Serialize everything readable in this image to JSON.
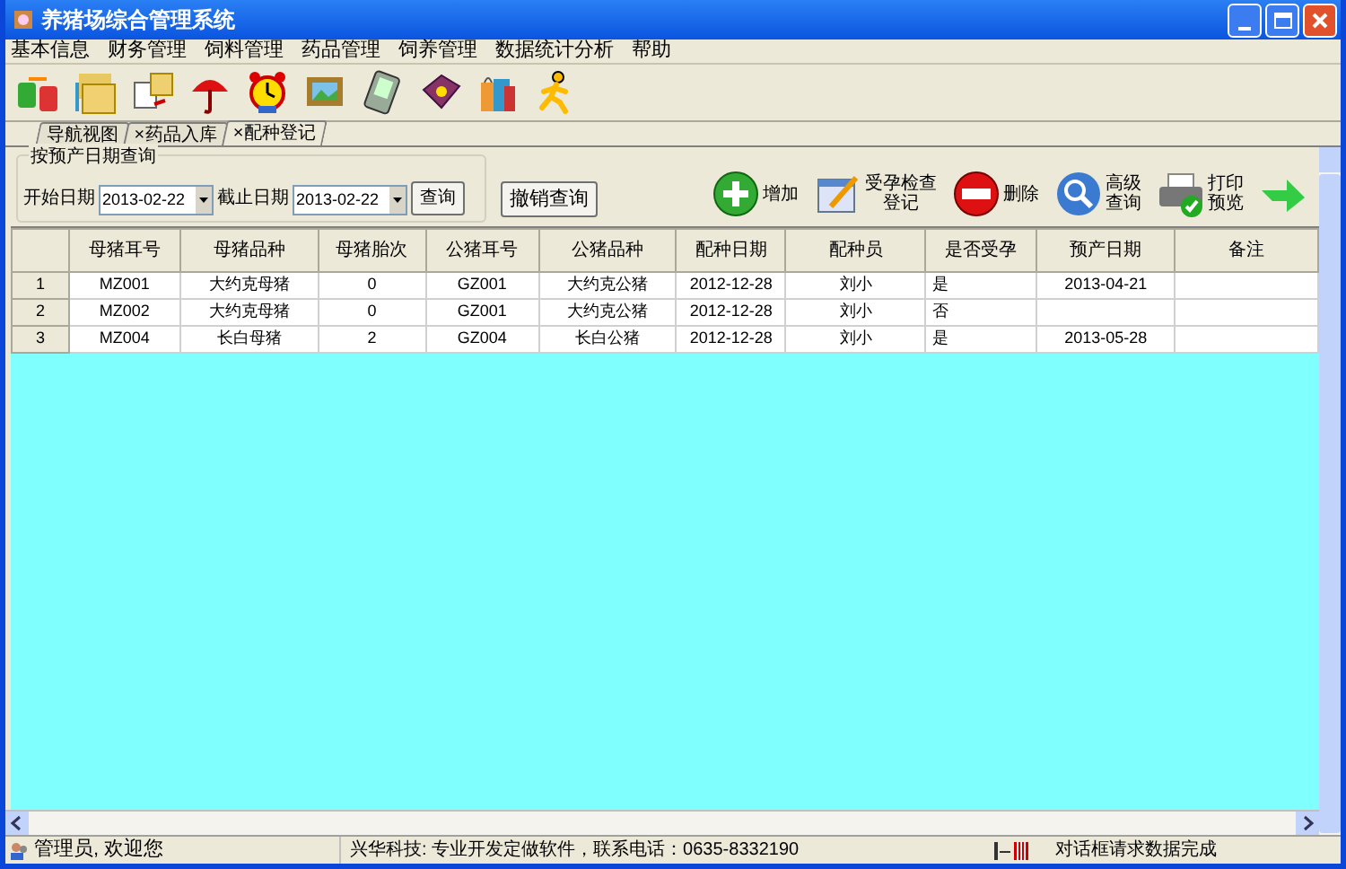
{
  "window": {
    "title": "养猪场综合管理系统"
  },
  "menu": [
    "基本信息",
    "财务管理",
    "饲料管理",
    "药品管理",
    "饲养管理",
    "数据统计分析",
    "帮助"
  ],
  "toolbar": [
    {
      "kind": "exchange"
    },
    {
      "kind": "folders"
    },
    {
      "kind": "documents"
    },
    {
      "kind": "umbrella"
    },
    {
      "kind": "clock"
    },
    {
      "kind": "picture"
    },
    {
      "kind": "pda"
    },
    {
      "kind": "book"
    },
    {
      "kind": "gift"
    },
    {
      "kind": "runner"
    }
  ],
  "tabs": [
    {
      "label": "导航视图",
      "selected": false
    },
    {
      "label": "药品入库",
      "close": "×",
      "selected": false
    },
    {
      "label": "配种登记",
      "close": "×",
      "selected": true
    }
  ],
  "query": {
    "title": "按预产日期查询",
    "start_label": "开始日期",
    "start_value": "2013-02-22",
    "end_label": "截止日期",
    "end_value": "2013-02-22",
    "search_button": "查询",
    "cancel_button": "撤销查询"
  },
  "actions": [
    {
      "kind": "add",
      "lines": [
        "增加"
      ]
    },
    {
      "kind": "edit",
      "lines": [
        "受孕检查",
        "登记"
      ]
    },
    {
      "kind": "delete",
      "lines": [
        "删除"
      ]
    },
    {
      "kind": "search",
      "lines": [
        "高级",
        "查询"
      ]
    },
    {
      "kind": "print",
      "lines": [
        "打印",
        "预览"
      ]
    },
    {
      "kind": "exit"
    }
  ],
  "table": {
    "columns": [
      "母猪耳号",
      "母猪品种",
      "母猪胎次",
      "公猪耳号",
      "公猪品种",
      "配种日期",
      "配种员",
      "是否受孕",
      "预产日期",
      "备注"
    ],
    "rows": [
      {
        "number": "1",
        "cells": [
          "MZ001",
          "大约克母猪",
          "0",
          "GZ001",
          "大约克公猪",
          "2012-12-28",
          "刘小",
          "是",
          "2013-04-21",
          ""
        ]
      },
      {
        "number": "2",
        "cells": [
          "MZ002",
          "大约克母猪",
          "0",
          "GZ001",
          "大约克公猪",
          "2012-12-28",
          "刘小",
          "否",
          "",
          ""
        ]
      },
      {
        "number": "3",
        "cells": [
          "MZ004",
          "长白母猪",
          "2",
          "GZ004",
          "长白公猪",
          "2012-12-28",
          "刘小",
          "是",
          "2013-05-28",
          ""
        ]
      }
    ]
  },
  "status_bar": {
    "user": "管理员, 欢迎您",
    "company": "兴华科技: 专业开发定做软件，联系电话：0635-8332190",
    "message": "对话框请求数据完成"
  }
}
